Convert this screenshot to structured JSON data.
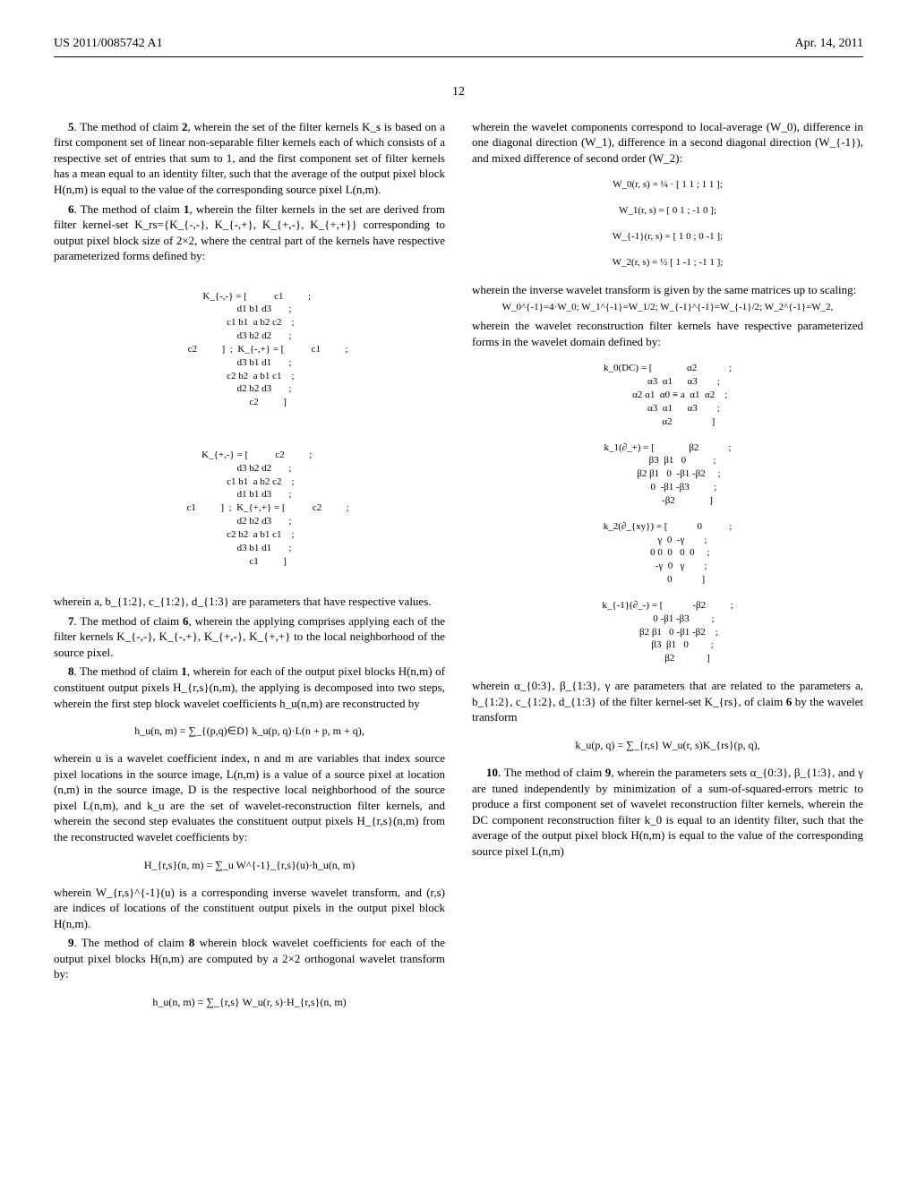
{
  "header": {
    "pubno": "US 2011/0085742 A1",
    "date": "Apr. 14, 2011"
  },
  "page_number": "12",
  "left": {
    "c5": {
      "num": "5",
      "text": ". The method of claim ",
      "ref": "2",
      "rest": ", wherein the set of the filter kernels K_s is based on a first component set of linear non-separable filter kernels each of which consists of a respective set of entries that sum to 1, and the first component set of filter kernels has a mean equal to an identity filter, such that the average of the output pixel block H(n,m) is equal to the value of the corresponding source pixel L(n,m)."
    },
    "c6": {
      "num": "6",
      "text": ". The method of claim ",
      "ref": "1",
      "rest": ", wherein the filter kernels in the set are derived from filter kernel-set K_rs={K_{-,-}, K_{-,+}, K_{+,-}, K_{+,+}} corresponding to output pixel block size of 2×2, where the central part of the kernels have respective parameterized forms defined by:"
    },
    "c6_after": "wherein a, b_{1:2}, c_{1:2}, d_{1:3} are parameters that have respective values.",
    "c7": {
      "num": "7",
      "text": ". The method of claim ",
      "ref": "6",
      "rest": ", wherein the applying comprises applying each of the filter kernels K_{-,-}, K_{-,+}, K_{+,-}, K_{+,+} to the local neighborhood of the source pixel."
    },
    "c8": {
      "num": "8",
      "text": ". The method of claim ",
      "ref": "1",
      "rest": ", wherein for each of the output pixel blocks H(n,m) of constituent output pixels H_{r,s}(n,m), the applying is decomposed into two steps, wherein the first step block wavelet coefficients h_u(n,m) are reconstructed by"
    },
    "c8_mid": "wherein u is a wavelet coefficient index, n and m are variables that index source pixel locations in the source image, L(n,m) is a value of a source pixel at location (n,m) in the source image, D is the respective local neighborhood of the source pixel L(n,m), and k_u are the set of wavelet-reconstruction filter kernels, and wherein the second step evaluates the constituent output pixels H_{r,s}(n,m) from the reconstructed wavelet coefficients by:",
    "c8_end": "wherein W_{r,s}^{-1}(u) is a corresponding inverse wavelet transform, and (r,s) are indices of locations of the constituent output pixels in the output pixel block H(n,m).",
    "c9": {
      "num": "9",
      "text": ". The method of claim ",
      "ref": "8",
      "rest": " wherein block wavelet coefficients for each of the output pixel blocks H(n,m) are computed by a 2×2 orthogonal wavelet transform by:"
    },
    "eq_hu": "h_u(n, m) = ∑_{(p,q)∈D} k_u(p, q)·L(n + p, m + q),",
    "eq_Hrs": "H_{r,s}(n, m) = ∑_u W^{-1}_{r,s}(u)·h_u(n, m)",
    "eq_hu2": "h_u(n, m) = ∑_{r,s} W_u(r, s)·H_{r,s}(n, m)"
  },
  "right": {
    "r1": "wherein the wavelet components correspond to local-average (W_0), difference in one diagonal direction (W_1), difference in a second diagonal direction (W_{-1}), and mixed difference of second order (W_2):",
    "r2": "wherein the inverse wavelet transform is given by the same matrices up to scaling:",
    "r2b": "W_0^{-1}=4·W_0; W_1^{-1}=W_1/2; W_{-1}^{-1}=W_{-1}/2; W_2^{-1}=W_2,",
    "r3": "wherein the wavelet reconstruction filter kernels have respective parameterized forms in the wavelet domain defined by:",
    "r4": "wherein α_{0:3}, β_{1:3}, γ are parameters that are related to the parameters a, b_{1:2}, c_{1:2}, d_{1:3} of the filter kernel-set K_{rs}, of claim ",
    "r4ref": "6",
    "r4end": " by the wavelet transform",
    "eq_ku": "k_u(p, q) = ∑_{r,s} W_u(r, s)K_{rs}(p, q),",
    "c10": {
      "num": "10",
      "text": ". The method of claim ",
      "ref": "9",
      "rest": ", wherein the parameters sets α_{0:3}, β_{1:3}, and γ are tuned independently by minimization of a sum-of-squared-errors metric to produce a first component set of wavelet reconstruction filter kernels, wherein the DC component reconstruction filter k_0 is equal to an identity filter, such that the average of the output pixel block H(n,m) is equal to the value of the corresponding source pixel L(n,m)"
    },
    "eq_W0": "W_0(r, s) = ¼ · [ 1 1 ; 1 1 ];",
    "eq_W1": "W_1(r, s) = [ 0 1 ; -1 0 ];",
    "eq_Wm1": "W_{-1}(r, s) = [ 1 0 ; 0 -1 ];",
    "eq_W2": "W_2(r, s) = ½ [ 1 -1 ; -1 1 ];"
  },
  "matrices": {
    "Kmm": "K_{-,-} = [           c1          ;\n            d1 b1 d3       ;\n         c1 b1  a b2 c2    ;\n            d3 b2 d2       ;\n               c2          ]",
    "Kmp": "K_{-,+} = [           c1          ;\n            d3 b1 d1       ;\n         c2 b2  a b1 c1    ;\n            d2 b2 d3       ;\n               c2          ]",
    "Kpm": "K_{+,-} = [           c2          ;\n            d3 b2 d2       ;\n         c1 b1  a b2 c2    ;\n            d1 b1 d3       ;\n               c1          ]",
    "Kpp": "K_{+,+} = [           c2          ;\n            d2 b2 d3       ;\n         c2 b2  a b1 c1    ;\n            d3 b1 d1       ;\n               c1          ]",
    "k0": "k_0(DC) = [              α2             ;\n             α3  α1      α3        ;\n          α2 α1  α0 ≡ a  α1  α2    ;\n             α3  α1      α3        ;\n                 α2                ]",
    "k1": "k_1(∂_+) = [              β2            ;\n            β3  β1   0           ;\n         β2 β1   0  -β1 -β2     ;\n             0  -β1 -β3          ;\n                -β2              ]",
    "k2": "k_2(∂_{xy}) = [            0           ;\n            γ  0  -γ        ;\n          0 0  0   0  0     ;\n           -γ  0   γ        ;\n               0            ]",
    "km1": "k_{-1}(∂_-) = [            -β2          ;\n             0 -β1 -β3         ;\n         β2 β1   0 -β1 -β2    ;\n            β3  β1   0         ;\n                β2             ]"
  }
}
